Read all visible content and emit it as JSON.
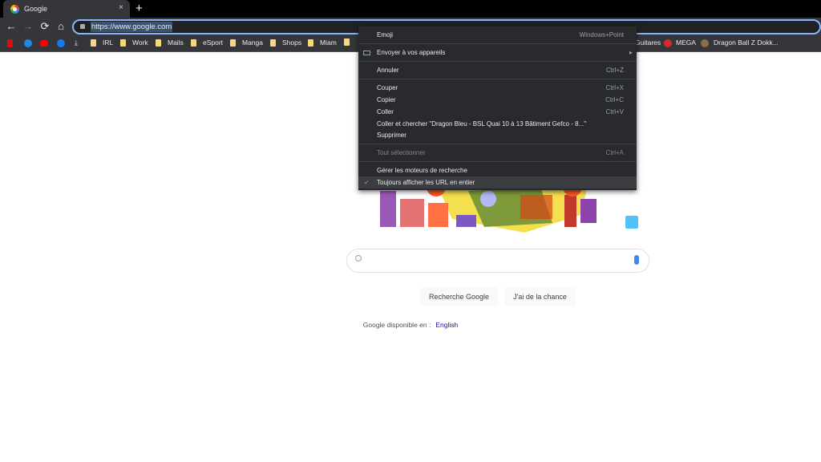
{
  "tab": {
    "title": "Google",
    "close": "×",
    "new_tab": "+"
  },
  "toolbar": {
    "back": "←",
    "forward": "→",
    "reload": "⟳",
    "home": "⌂",
    "url": "https://www.google.com"
  },
  "bookmarks": {
    "folders": [
      "IRL",
      "Work",
      "Mails",
      "eSport",
      "Manga",
      "Shops",
      "Miam"
    ],
    "partial": "Guitares",
    "mega": "MEGA",
    "dokkan": "Dragon Ball Z Dokk...",
    "download": "⤓"
  },
  "context_menu": {
    "emoji": {
      "label": "Emoji",
      "shortcut": "Windows+Point"
    },
    "send": {
      "label": "Envoyer à vos appareils",
      "arrow": "▸"
    },
    "undo": {
      "label": "Annuler",
      "shortcut": "Ctrl+Z"
    },
    "cut": {
      "label": "Couper",
      "shortcut": "Ctrl+X"
    },
    "copy": {
      "label": "Copier",
      "shortcut": "Ctrl+C"
    },
    "paste": {
      "label": "Coller",
      "shortcut": "Ctrl+V"
    },
    "paste_search": {
      "label": "Coller et chercher \"Dragon Bleu - BSL Quai 10 à 13 Bâtiment Gefco - 8...\""
    },
    "delete": {
      "label": "Supprimer"
    },
    "select_all": {
      "label": "Tout sélectionner",
      "shortcut": "Ctrl+A"
    },
    "manage_engines": {
      "label": "Gérer les moteurs de recherche"
    },
    "show_full_urls": {
      "label": "Toujours afficher les URL en entier",
      "check": "✓"
    }
  },
  "page": {
    "search_button": "Recherche Google",
    "lucky_button": "J'ai de la chance",
    "lang_prefix": "Google disponible en :",
    "lang_link": "English"
  }
}
